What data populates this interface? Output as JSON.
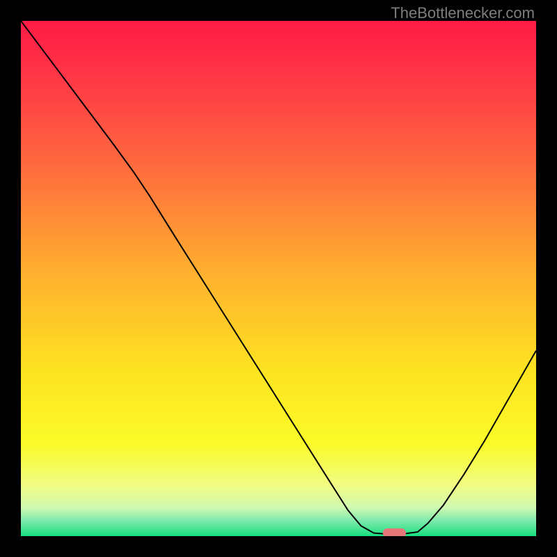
{
  "watermark": "TheBottlenecker.com",
  "chart_data": {
    "type": "line",
    "title": "",
    "xlabel": "",
    "ylabel": "",
    "xlim": [
      0,
      100
    ],
    "ylim": [
      0,
      100
    ],
    "background": {
      "type": "vertical_gradient",
      "stops": [
        {
          "pos": 0.0,
          "color": "#ff1b44"
        },
        {
          "pos": 0.1,
          "color": "#ff3447"
        },
        {
          "pos": 0.28,
          "color": "#ff6a3e"
        },
        {
          "pos": 0.5,
          "color": "#ffb32e"
        },
        {
          "pos": 0.68,
          "color": "#fde321"
        },
        {
          "pos": 0.82,
          "color": "#fbfb28"
        },
        {
          "pos": 0.9,
          "color": "#f1fc82"
        },
        {
          "pos": 0.945,
          "color": "#d0f9b0"
        },
        {
          "pos": 0.97,
          "color": "#7ee9ad"
        },
        {
          "pos": 1.0,
          "color": "#18e07c"
        }
      ]
    },
    "series": [
      {
        "name": "bottleneck-curve",
        "stroke": "#000000",
        "stroke_width": 2,
        "points": [
          {
            "x": 0.0,
            "y": 100.0
          },
          {
            "x": 6.0,
            "y": 92.0
          },
          {
            "x": 12.0,
            "y": 84.0
          },
          {
            "x": 18.0,
            "y": 76.0
          },
          {
            "x": 22.0,
            "y": 70.5
          },
          {
            "x": 25.0,
            "y": 66.0
          },
          {
            "x": 30.0,
            "y": 58.0
          },
          {
            "x": 36.0,
            "y": 48.5
          },
          {
            "x": 42.0,
            "y": 39.0
          },
          {
            "x": 48.0,
            "y": 29.5
          },
          {
            "x": 54.0,
            "y": 20.0
          },
          {
            "x": 60.0,
            "y": 10.5
          },
          {
            "x": 63.5,
            "y": 5.0
          },
          {
            "x": 66.0,
            "y": 2.0
          },
          {
            "x": 68.5,
            "y": 0.6
          },
          {
            "x": 71.0,
            "y": 0.4
          },
          {
            "x": 74.0,
            "y": 0.4
          },
          {
            "x": 77.0,
            "y": 0.8
          },
          {
            "x": 79.0,
            "y": 2.5
          },
          {
            "x": 82.0,
            "y": 6.0
          },
          {
            "x": 86.0,
            "y": 12.0
          },
          {
            "x": 90.0,
            "y": 18.5
          },
          {
            "x": 94.0,
            "y": 25.5
          },
          {
            "x": 98.0,
            "y": 32.5
          },
          {
            "x": 100.0,
            "y": 36.0
          }
        ]
      }
    ],
    "marker": {
      "name": "optimal-marker",
      "x": 72.5,
      "y": 0.6,
      "color": "#e77679",
      "width": 4.5,
      "height": 1.8
    }
  }
}
